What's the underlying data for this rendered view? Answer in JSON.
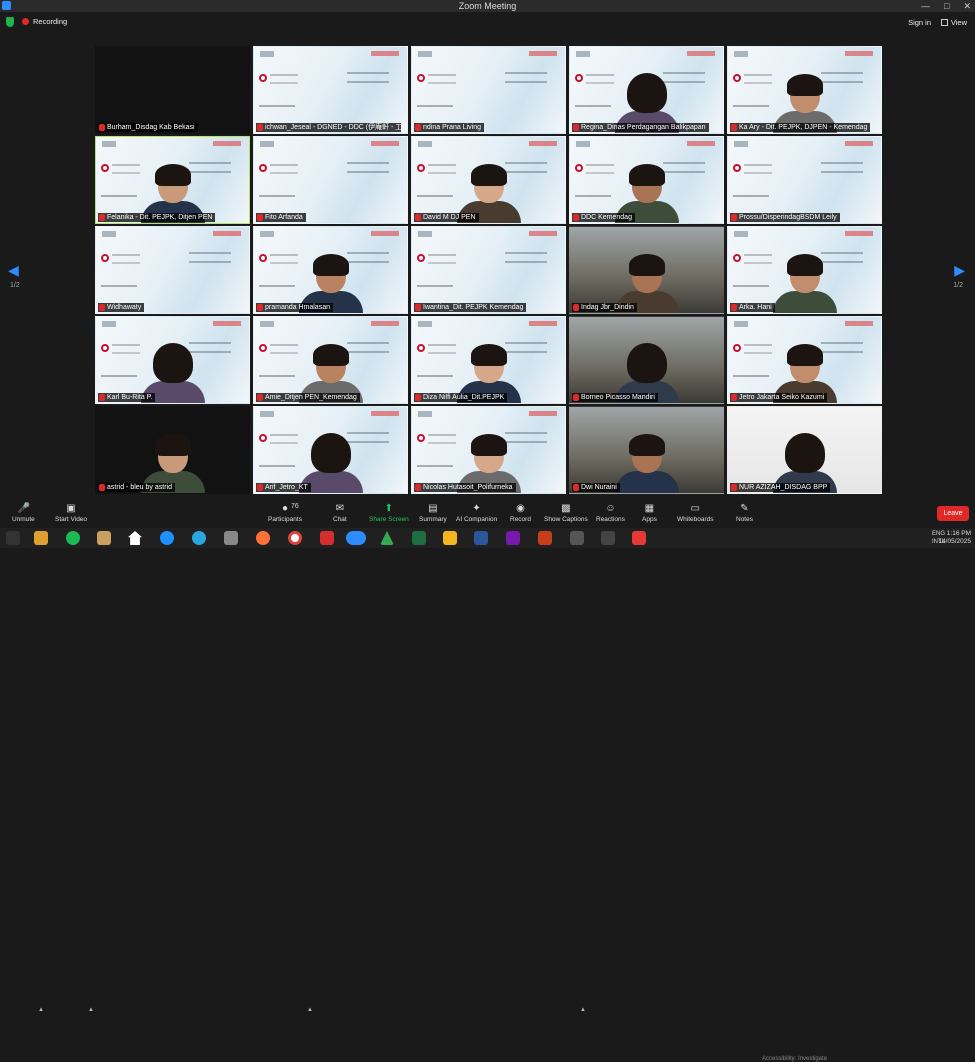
{
  "window": {
    "title": "Zoom Meeting"
  },
  "header": {
    "recording": "Recording",
    "signin": "Sign in",
    "view": "View"
  },
  "pager": {
    "left": "1/2",
    "right": "1/2"
  },
  "tiles": [
    {
      "name": "Burham_Disdag Kab Bekasi",
      "kind": "dark"
    },
    {
      "name": "ichwan_Jeseal - DGNED - DDC (伊庵軒 - 工",
      "kind": "slide"
    },
    {
      "name": "ndina Prana Living",
      "kind": "slide"
    },
    {
      "name": "Regina_Dinas Perdagangan Balikpapan",
      "kind": "slide-person"
    },
    {
      "name": "Ka Ary - Dit. PEJPK, DJPEN - Kemendag",
      "kind": "slide-person"
    },
    {
      "name": "Felanika - Dit. PEJPK, Ditjen PEN",
      "kind": "slide-person",
      "active": true
    },
    {
      "name": "Fito Arfanda",
      "kind": "slide"
    },
    {
      "name": "David M DJ PEN",
      "kind": "slide-person"
    },
    {
      "name": "DDC Kemendag",
      "kind": "slide-person"
    },
    {
      "name": "Prossu/DisperindagBSDM Leily",
      "kind": "slide"
    },
    {
      "name": "Widhawaty",
      "kind": "slide"
    },
    {
      "name": "pramanda Hmalasan",
      "kind": "slide-person"
    },
    {
      "name": "Iwantina_Dit. PEJPK Kemendag",
      "kind": "slide"
    },
    {
      "name": "Indag Jbr_Dindin",
      "kind": "room-person"
    },
    {
      "name": "Arka. Hani",
      "kind": "slide-person"
    },
    {
      "name": "Karl Bu-Rita P.",
      "kind": "slide-person"
    },
    {
      "name": "Amie_Ditjen PEN_Kemendag",
      "kind": "slide-person"
    },
    {
      "name": "Diza Nilfi Aulia_Dit.PEJPK",
      "kind": "slide-person"
    },
    {
      "name": "Borneo Picasso Mandiri",
      "kind": "room-person"
    },
    {
      "name": "Jetro Jakarta Seiko Kazumi",
      "kind": "slide-person"
    },
    {
      "name": "astrid - bleu by astrid",
      "kind": "dark-person"
    },
    {
      "name": "Arif_Jetro_KT",
      "kind": "slide-person"
    },
    {
      "name": "Nicolas Hutasoit_Polifurneka",
      "kind": "slide-person"
    },
    {
      "name": "Dwi Nuraini",
      "kind": "room-person"
    },
    {
      "name": "NUR AZIZAH_DISDAG BPP",
      "kind": "wall-person"
    }
  ],
  "toolbar": {
    "unmute": "Unmute",
    "start_video": "Start Video",
    "participants": "Participants",
    "participant_count": "76",
    "chat": "Chat",
    "share_screen": "Share Screen",
    "summary": "Summary",
    "ai_companion": "AI Companion",
    "record": "Record",
    "show_captions": "Show Captions",
    "reactions": "Reactions",
    "apps": "Apps",
    "whiteboards": "Whiteboards",
    "notes": "Notes",
    "leave": "Leave"
  },
  "taskbar": {
    "lang1": "ENG",
    "lang2": "INTL",
    "time": "1:16 PM",
    "date": "14/05/2025",
    "accessibility": "Accessibility: Investigate"
  }
}
